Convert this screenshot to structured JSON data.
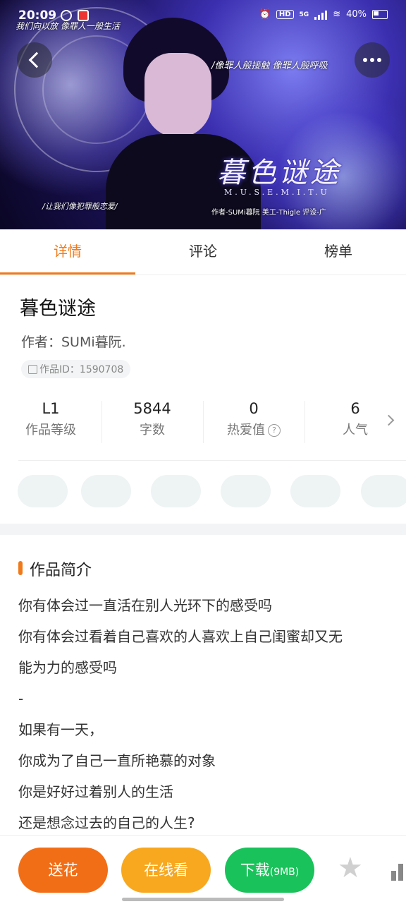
{
  "status_bar": {
    "time": "20:09",
    "network": "5G",
    "battery": "40%"
  },
  "hero": {
    "art_title": "暮色谜途",
    "art_subtitle": "M.U.S.E.M.I.T.U",
    "caption_top_left": "我们向以放 像罪人一般生活",
    "caption_right": "/像罪人般接触 像罪人般呼吸",
    "caption_bottom_left": "/让我们像犯罪般恋爱/",
    "caption_credit": "作者-SUMi暮阮 美工-Thigle 评设-广"
  },
  "tabs": [
    {
      "label": "详情",
      "active": true
    },
    {
      "label": "评论",
      "active": false
    },
    {
      "label": "榜单",
      "active": false
    }
  ],
  "work": {
    "title": "暮色谜途",
    "author": "作者：SUMi暮阮.",
    "id_label": "作品ID：1590708"
  },
  "stats": [
    {
      "value": "L1",
      "label": "作品等级"
    },
    {
      "value": "5844",
      "label": "字数"
    },
    {
      "value": "0",
      "label": "热爱值",
      "help_icon": "?"
    },
    {
      "value": "6",
      "label": "人气"
    }
  ],
  "intro": {
    "heading": "作品简介",
    "lines": [
      "你有体会过一直活在别人光环下的感受吗",
      "你有体会过看着自己喜欢的人喜欢上自己闺蜜却又无",
      "能为力的感受吗",
      "-",
      "如果有一天，",
      "你成为了自己一直所艳慕的对象",
      "你是好好过着别人的生活",
      "还是想念过去的自己的人生?"
    ]
  },
  "bottom_bar": {
    "flower": "送花",
    "online": "在线看",
    "download": "下载",
    "download_size": "(9MB)"
  },
  "colors": {
    "accent": "#f07a1a",
    "flower": "#f26e16",
    "online": "#f8a81e",
    "download": "#19c25a"
  }
}
